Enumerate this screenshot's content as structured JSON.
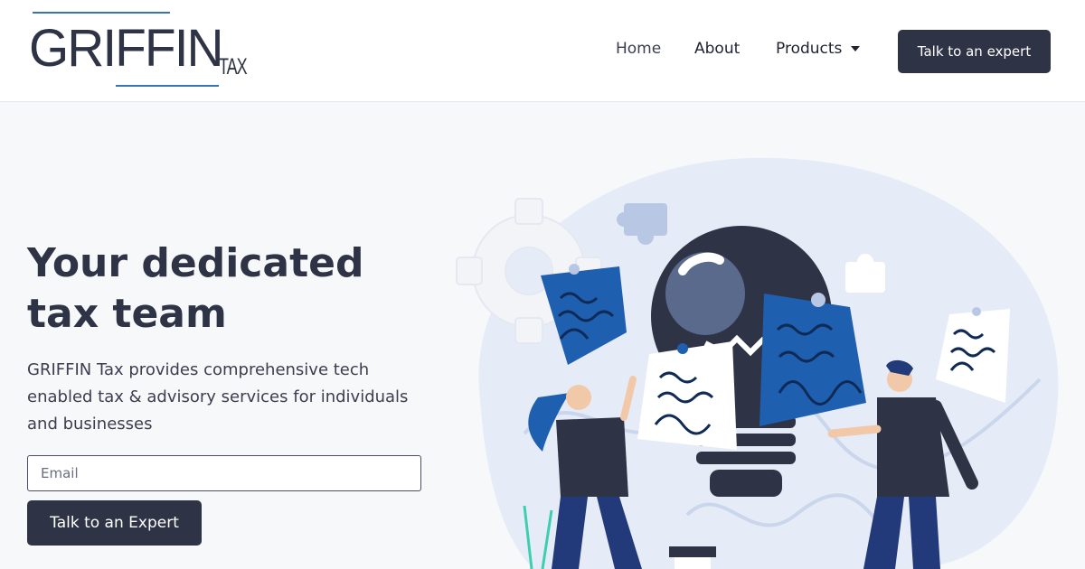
{
  "brand": {
    "logo_text": "GRIFFIN",
    "logo_suffix": "TAX"
  },
  "nav": {
    "items": [
      "Home",
      "About",
      "Products"
    ],
    "cta_label": "Talk to an expert"
  },
  "hero": {
    "title_line1": "Your dedicated",
    "title_line2": "tax team",
    "subtitle": "GRIFFIN Tax provides comprehensive tech enabled tax & advisory services for individuals and businesses",
    "email_placeholder": "Email",
    "cta_label": "Talk to an Expert"
  },
  "colors": {
    "primary": "#2f3346",
    "accent_blue": "#1f5fb0",
    "logo_line": "#3a72b8",
    "page_bg": "#f7f8fa"
  },
  "icons": [
    "caret-down-icon",
    "lightbulb-illustration",
    "puzzle-icon",
    "gear-icon",
    "sticky-note-icon"
  ]
}
